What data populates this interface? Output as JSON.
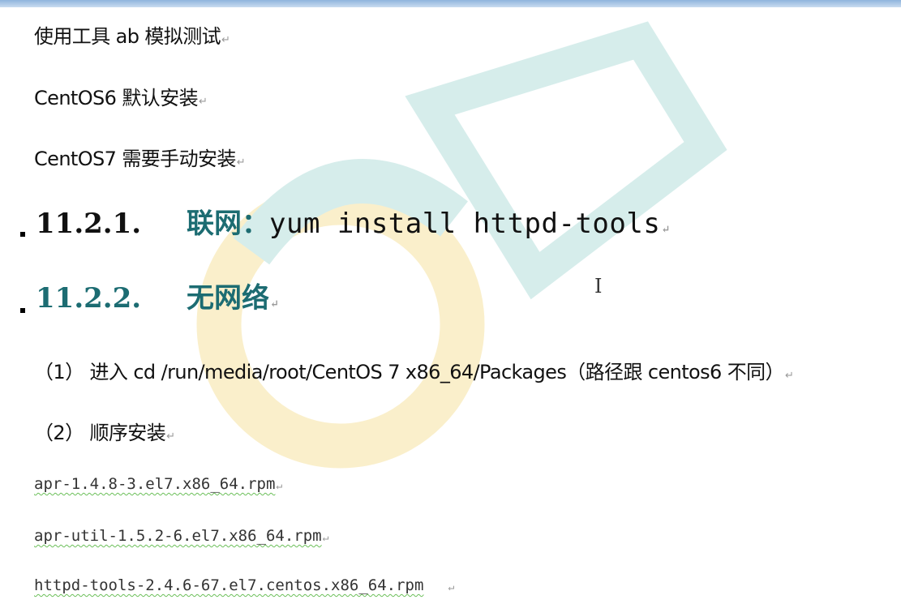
{
  "lines": {
    "l1": "使用工具 ab 模拟测试",
    "l2": "CentOS6 默认安装",
    "l3": "CentOS7 需要手动安装",
    "h1_num": "11.2.1.",
    "h1_label": "联网：",
    "h1_cmd": "yum install httpd-tools",
    "h2_num": "11.2.2.",
    "h2_label": "无网络",
    "p1": "（1） 进入 cd   /run/media/root/CentOS 7 x86_64/Packages（路径跟 centos6 不同）",
    "p2": "（2） 顺序安装",
    "rpm1": "apr-1.4.8-3.el7.x86_64.rpm",
    "rpm2": "apr-util-1.5.2-6.el7.x86_64.rpm",
    "rpm3": "httpd-tools-2.4.6-67.el7.centos.x86_64.rpm"
  },
  "paragraph_mark": "↵",
  "cursor_glyph": "I",
  "colors": {
    "heading": "#1c6c72",
    "text": "#111111",
    "spell_underline": "#6bbf59"
  }
}
